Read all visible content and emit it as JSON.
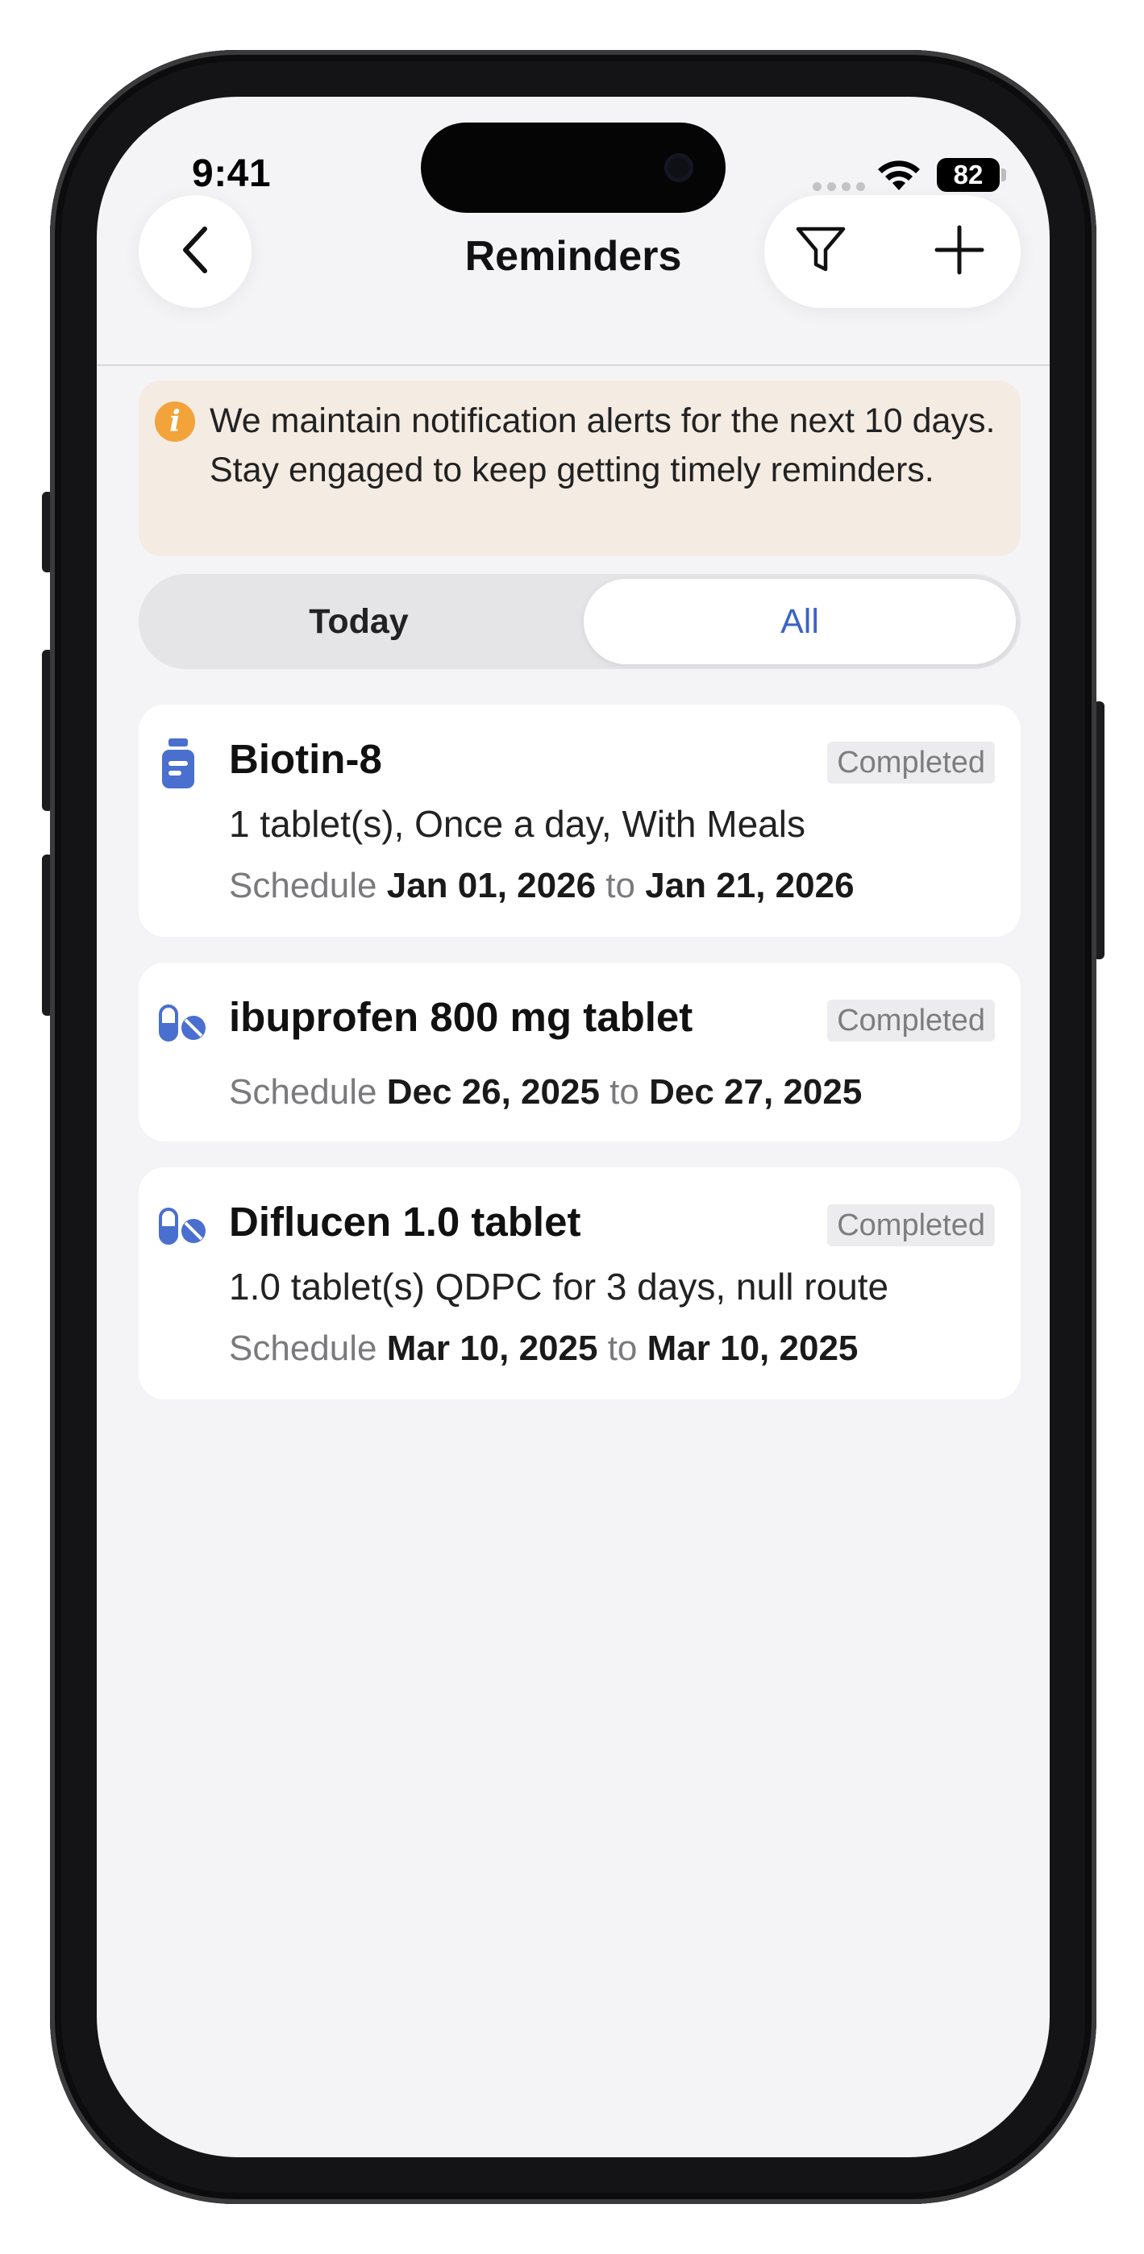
{
  "status_bar": {
    "time": "9:41",
    "battery": "82"
  },
  "header": {
    "title": "Reminders"
  },
  "banner": {
    "text": "We maintain notification alerts for the next 10 days. Stay engaged to keep getting timely reminders."
  },
  "tabs": {
    "today": "Today",
    "all": "All",
    "selected": "All"
  },
  "reminders": [
    {
      "icon": "medicine-bottle-icon",
      "name": "Biotin-8",
      "status": "Completed",
      "dose": "1 tablet(s), Once a day, With Meals",
      "schedule_label": "Schedule",
      "start": "Jan 01, 2026",
      "to_label": "to",
      "end": "Jan 21, 2026"
    },
    {
      "icon": "pills-icon",
      "name": "ibuprofen 800 mg tablet",
      "status": "Completed",
      "dose": "",
      "schedule_label": "Schedule",
      "start": "Dec 26, 2025",
      "to_label": "to",
      "end": "Dec 27, 2025"
    },
    {
      "icon": "pills-icon",
      "name": "Diflucen 1.0 tablet",
      "status": "Completed",
      "dose": "1.0 tablet(s) QDPC for 3 days, null route",
      "schedule_label": "Schedule",
      "start": "Mar 10, 2025",
      "to_label": "to",
      "end": "Mar 10, 2025"
    }
  ],
  "colors": {
    "accent": "#3a66c4",
    "banner_bg": "#f4ebe3",
    "info_icon": "#f2a33a",
    "med_icon": "#4a6fcf",
    "badge_bg": "#ececee"
  }
}
